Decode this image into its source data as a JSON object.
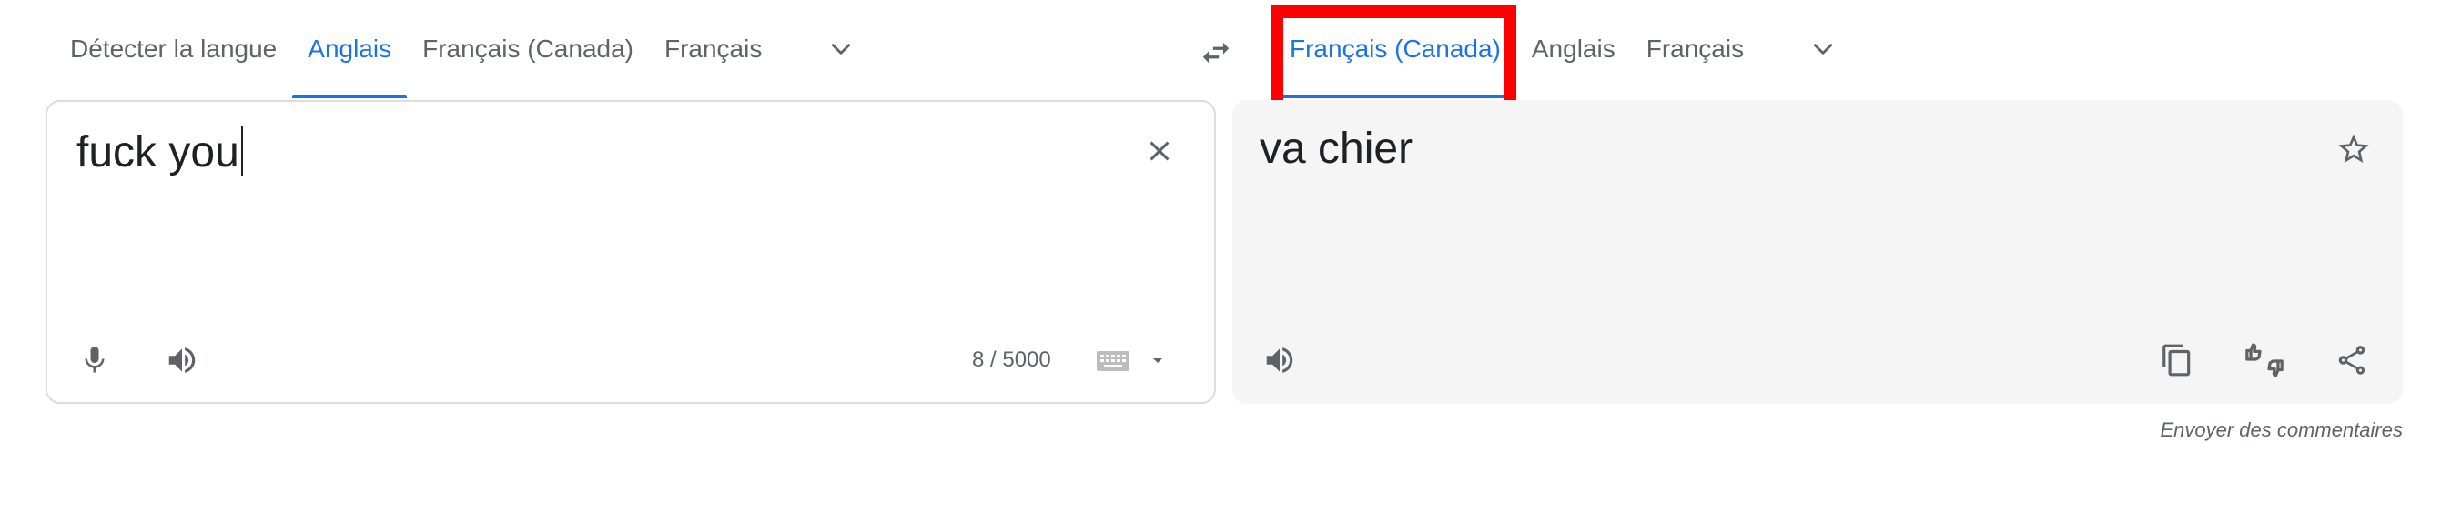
{
  "source_languages": {
    "tabs": [
      {
        "label": "Détecter la langue",
        "active": false
      },
      {
        "label": "Anglais",
        "active": true
      },
      {
        "label": "Français (Canada)",
        "active": false
      },
      {
        "label": "Français",
        "active": false
      }
    ],
    "more_icon": "chevron-down-icon"
  },
  "swap_icon": "swap-arrows-icon",
  "target_languages": {
    "tabs": [
      {
        "label": "Français (Canada)",
        "active": true
      },
      {
        "label": "Anglais",
        "active": false
      },
      {
        "label": "Français",
        "active": false
      }
    ],
    "more_icon": "chevron-down-icon"
  },
  "source_panel": {
    "text": "fuck you",
    "char_count": "8 / 5000",
    "icons": [
      "close-icon",
      "microphone-icon",
      "speaker-icon",
      "keyboard-icon",
      "caret-down-icon"
    ]
  },
  "target_panel": {
    "text": "va chier",
    "icons": [
      "star-icon",
      "speaker-icon",
      "copy-icon",
      "feedback-thumbs-icon",
      "share-icon"
    ]
  },
  "feedback_link": "Envoyer des commentaires",
  "colors": {
    "accent": "#1a73e8",
    "highlight": "#ff0000",
    "target_bg": "#f5f5f5",
    "border": "#dadce0",
    "icon": "#5f6368"
  }
}
